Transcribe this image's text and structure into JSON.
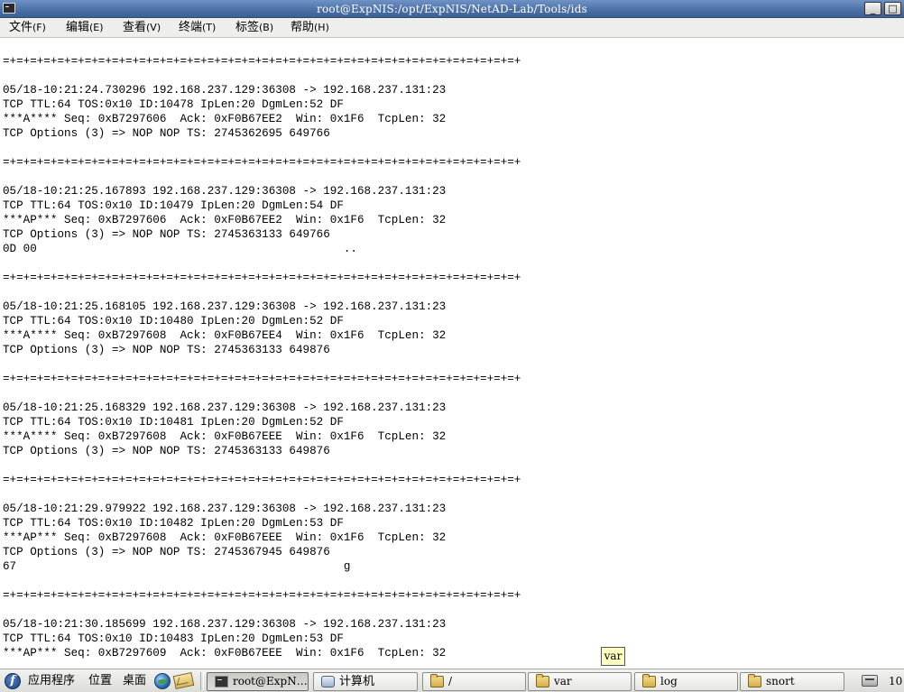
{
  "window": {
    "title": "root@ExpNIS:/opt/ExpNIS/NetAD-Lab/Tools/ids",
    "minimize_icon": "minimize-icon",
    "maximize_icon": "maximize-icon"
  },
  "menubar": {
    "items": [
      {
        "label": "文件",
        "accel": "(F)"
      },
      {
        "label": "编辑",
        "accel": "(E)"
      },
      {
        "label": "查看",
        "accel": "(V)"
      },
      {
        "label": "终端",
        "accel": "(T)"
      },
      {
        "label": "标签",
        "accel": "(B)"
      },
      {
        "label": "帮助",
        "accel": "(H)"
      }
    ]
  },
  "terminal": {
    "lines": [
      "",
      "=+=+=+=+=+=+=+=+=+=+=+=+=+=+=+=+=+=+=+=+=+=+=+=+=+=+=+=+=+=+=+=+=+=+=+=+=+=+",
      "",
      "05/18-10:21:24.730296 192.168.237.129:36308 -> 192.168.237.131:23",
      "TCP TTL:64 TOS:0x10 ID:10478 IpLen:20 DgmLen:52 DF",
      "***A**** Seq: 0xB7297606  Ack: 0xF0B67EE2  Win: 0x1F6  TcpLen: 32",
      "TCP Options (3) => NOP NOP TS: 2745362695 649766",
      "",
      "=+=+=+=+=+=+=+=+=+=+=+=+=+=+=+=+=+=+=+=+=+=+=+=+=+=+=+=+=+=+=+=+=+=+=+=+=+=+",
      "",
      "05/18-10:21:25.167893 192.168.237.129:36308 -> 192.168.237.131:23",
      "TCP TTL:64 TOS:0x10 ID:10479 IpLen:20 DgmLen:54 DF",
      "***AP*** Seq: 0xB7297606  Ack: 0xF0B67EE2  Win: 0x1F6  TcpLen: 32",
      "TCP Options (3) => NOP NOP TS: 2745363133 649766",
      "0D 00                                             ..",
      "",
      "=+=+=+=+=+=+=+=+=+=+=+=+=+=+=+=+=+=+=+=+=+=+=+=+=+=+=+=+=+=+=+=+=+=+=+=+=+=+",
      "",
      "05/18-10:21:25.168105 192.168.237.129:36308 -> 192.168.237.131:23",
      "TCP TTL:64 TOS:0x10 ID:10480 IpLen:20 DgmLen:52 DF",
      "***A**** Seq: 0xB7297608  Ack: 0xF0B67EE4  Win: 0x1F6  TcpLen: 32",
      "TCP Options (3) => NOP NOP TS: 2745363133 649876",
      "",
      "=+=+=+=+=+=+=+=+=+=+=+=+=+=+=+=+=+=+=+=+=+=+=+=+=+=+=+=+=+=+=+=+=+=+=+=+=+=+",
      "",
      "05/18-10:21:25.168329 192.168.237.129:36308 -> 192.168.237.131:23",
      "TCP TTL:64 TOS:0x10 ID:10481 IpLen:20 DgmLen:52 DF",
      "***A**** Seq: 0xB7297608  Ack: 0xF0B67EEE  Win: 0x1F6  TcpLen: 32",
      "TCP Options (3) => NOP NOP TS: 2745363133 649876",
      "",
      "=+=+=+=+=+=+=+=+=+=+=+=+=+=+=+=+=+=+=+=+=+=+=+=+=+=+=+=+=+=+=+=+=+=+=+=+=+=+",
      "",
      "05/18-10:21:29.979922 192.168.237.129:36308 -> 192.168.237.131:23",
      "TCP TTL:64 TOS:0x10 ID:10482 IpLen:20 DgmLen:53 DF",
      "***AP*** Seq: 0xB7297608  Ack: 0xF0B67EEE  Win: 0x1F6  TcpLen: 32",
      "TCP Options (3) => NOP NOP TS: 2745367945 649876",
      "67                                                g",
      "",
      "=+=+=+=+=+=+=+=+=+=+=+=+=+=+=+=+=+=+=+=+=+=+=+=+=+=+=+=+=+=+=+=+=+=+=+=+=+=+",
      "",
      "05/18-10:21:30.185699 192.168.237.129:36308 -> 192.168.237.131:23",
      "TCP TTL:64 TOS:0x10 ID:10483 IpLen:20 DgmLen:53 DF",
      "***AP*** Seq: 0xB7297609  Ack: 0xF0B67EEE  Win: 0x1F6  TcpLen: 32"
    ]
  },
  "tooltip": {
    "text": "var"
  },
  "taskbar": {
    "menus": {
      "applications": "应用程序",
      "places": "位置",
      "desktop": "桌面"
    },
    "icons": {
      "distro": "fedora-logo-icon",
      "browser": "globe-icon",
      "mail": "mail-icon",
      "tray": "printer-icon"
    },
    "tasks": [
      {
        "label": "root@ExpN…",
        "icon": "terminal-icon",
        "active": true
      },
      {
        "label": "计算机",
        "icon": "calculator-icon",
        "active": false
      },
      {
        "label": "/",
        "icon": "folder-icon",
        "active": false
      },
      {
        "label": "var",
        "icon": "folder-icon",
        "active": false
      },
      {
        "label": "log",
        "icon": "folder-icon",
        "active": false
      },
      {
        "label": "snort",
        "icon": "folder-icon",
        "active": false
      }
    ],
    "clock": "10"
  }
}
